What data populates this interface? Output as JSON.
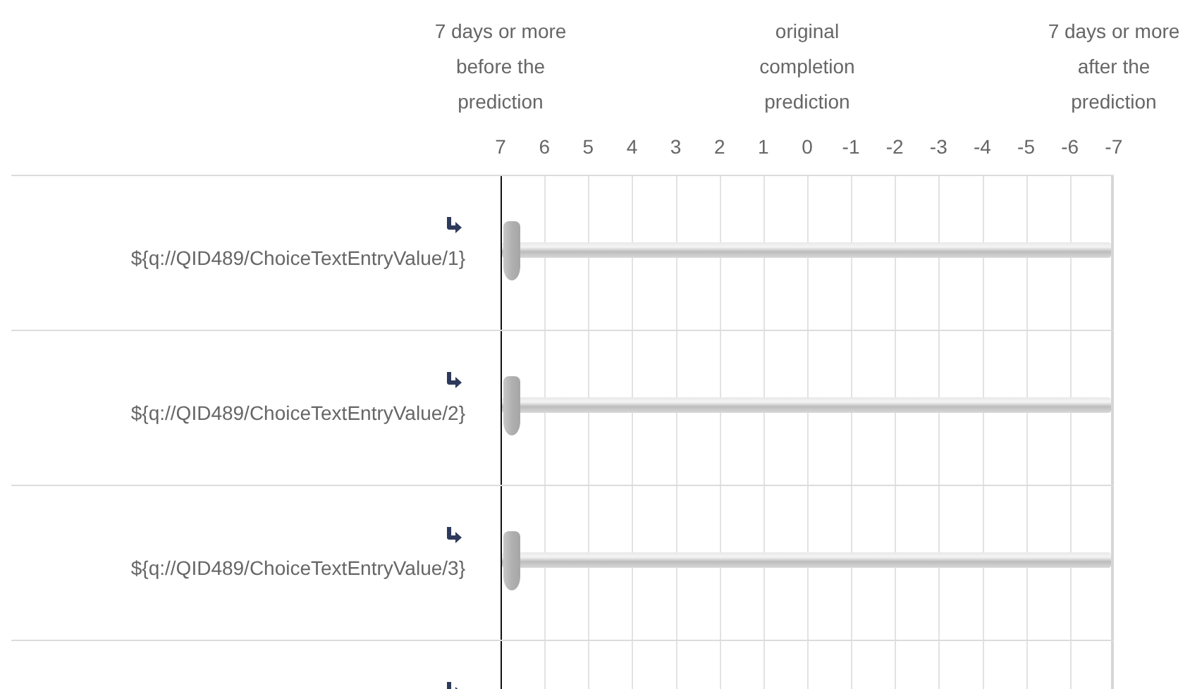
{
  "scale_labels": [
    "7 days or more before the prediction",
    "original completion prediction",
    "7 days or more after the prediction"
  ],
  "ticks": [
    "7",
    "6",
    "5",
    "4",
    "3",
    "2",
    "1",
    "0",
    "-1",
    "-2",
    "-3",
    "-4",
    "-5",
    "-6",
    "-7"
  ],
  "rows": [
    {
      "kind": "slider",
      "label": "${q://QID489/ChoiceTextEntryValue/1}",
      "level": 0
    },
    {
      "kind": "slider",
      "label": "${q://QID489/ChoiceTextEntryValue/2}",
      "level": 0
    },
    {
      "kind": "slider",
      "label": "${q://QID489/ChoiceTextEntryValue/3}",
      "level": 0
    },
    {
      "kind": "cut"
    }
  ]
}
